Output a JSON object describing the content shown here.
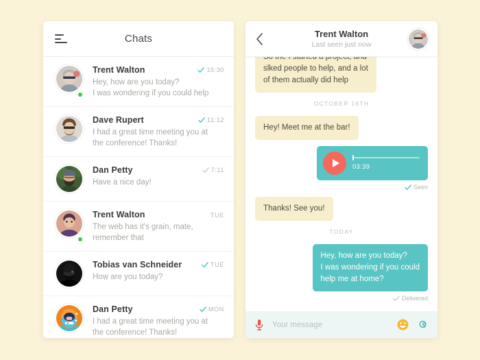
{
  "theme": {
    "page_background": "#faf3d8",
    "panel_background": "#ffffff",
    "accent_teal": "#58c4c3",
    "accent_coral": "#f4695c",
    "bubble_in": "#f6eecc",
    "bubble_out": "#58c4c3",
    "online_green": "#3dcb4c",
    "composer_background": "#eef6f5"
  },
  "chats_panel": {
    "menu_icon": "hamburger-icon",
    "title": "Chats",
    "rows": [
      {
        "name": "Trent Walton",
        "preview_line1": "Hey, how are you today?",
        "preview_line2": "I was wondering if you could help",
        "time": "15:30",
        "tick": "read",
        "online": true,
        "avatar": "photo-man-glasses-gray-hair"
      },
      {
        "name": "Dave Rupert",
        "preview_line1": "I had a great time meeting you at",
        "preview_line2": "the conference! Thanks!",
        "time": "11:12",
        "tick": "read",
        "online": false,
        "avatar": "photo-man-beard-glasses"
      },
      {
        "name": "Dan Petty",
        "preview_line1": "Have a nice day!",
        "preview_line2": "",
        "time": "7:11",
        "tick": "sent",
        "online": false,
        "avatar": "photo-man-beanie-beard"
      },
      {
        "name": "Trent Walton",
        "preview_line1": "The web has it's grain, mate,",
        "preview_line2": "remember that",
        "time": "TUE",
        "tick": "none",
        "online": true,
        "avatar": "photo-man-purple-shirt"
      },
      {
        "name": "Tobias van Schneider",
        "preview_line1": "How are you today?",
        "preview_line2": "",
        "time": "TUE",
        "tick": "read",
        "online": false,
        "avatar": "photo-man-dark-portrait"
      },
      {
        "name": "Dan Petty",
        "preview_line1": "I had a great time meeting you at",
        "preview_line2": "the conference! Thanks!",
        "time": "MON",
        "tick": "read",
        "online": false,
        "avatar": "illustration-astronaut-helmet"
      }
    ]
  },
  "conversation_panel": {
    "back_icon": "chevron-left-icon",
    "contact_name": "Trent Walton",
    "contact_status": "Last seen just now",
    "contact_avatar": "photo-man-glasses-gray-hair",
    "messages": [
      {
        "type": "text",
        "direction": "in",
        "clipped": true,
        "lines": [
          "So the I started a project, and",
          "slked people to help, and a lot",
          "of them actually did help"
        ]
      },
      {
        "type": "divider",
        "label": "OCTOBER 16TH"
      },
      {
        "type": "text",
        "direction": "in",
        "lines": [
          "Hey! Meet me at the bar!"
        ]
      },
      {
        "type": "audio",
        "direction": "out",
        "duration": "03:39",
        "play_icon": "play-icon",
        "progress_percent": 1,
        "status": "Seen",
        "status_tick": "read"
      },
      {
        "type": "text",
        "direction": "in",
        "lines": [
          "Thanks! See you!"
        ]
      },
      {
        "type": "divider",
        "label": "TODAY"
      },
      {
        "type": "text",
        "direction": "out",
        "lines": [
          "Hey, how are you today?",
          "I was wondering if you could",
          "help me at home?"
        ],
        "status": "Delivered",
        "status_tick": "sent"
      }
    ],
    "composer": {
      "mic_icon": "microphone-icon",
      "placeholder": "Your message",
      "value": "",
      "emoji_icon": "smiley-icon",
      "attach_icon": "paperclip-icon"
    }
  }
}
